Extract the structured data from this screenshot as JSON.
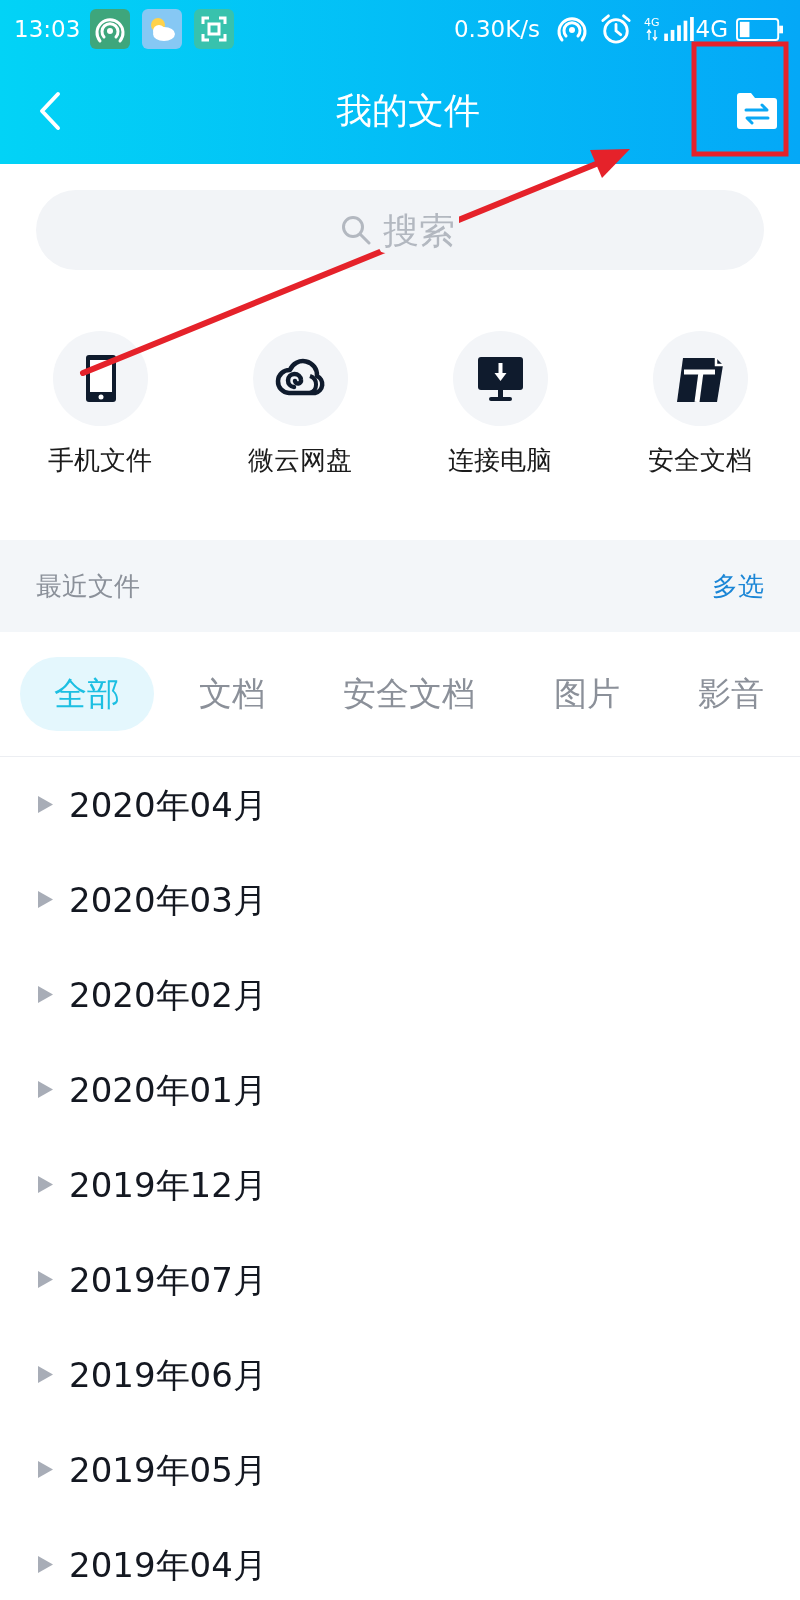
{
  "status_bar": {
    "time": "13:03",
    "net_speed": "0.30K/s",
    "network_badge": "4G",
    "network": "4G"
  },
  "header": {
    "title": "我的文件"
  },
  "search": {
    "placeholder": "搜索"
  },
  "shortcuts": [
    {
      "kind": "phone",
      "label": "手机文件"
    },
    {
      "kind": "cloud",
      "label": "微云网盘"
    },
    {
      "kind": "computer",
      "label": "连接电脑"
    },
    {
      "kind": "secure-doc",
      "label": "安全文档"
    }
  ],
  "recent": {
    "title": "最近文件",
    "action": "多选"
  },
  "tabs": [
    {
      "label": "全部",
      "selected": true
    },
    {
      "label": "文档",
      "selected": false
    },
    {
      "label": "安全文档",
      "selected": false
    },
    {
      "label": "图片",
      "selected": false
    },
    {
      "label": "影音",
      "selected": false
    }
  ],
  "months": [
    {
      "label": "2020年04月",
      "expanded": false
    },
    {
      "label": "2020年03月",
      "expanded": false
    },
    {
      "label": "2020年02月",
      "expanded": false
    },
    {
      "label": "2020年01月",
      "expanded": false
    },
    {
      "label": "2019年12月",
      "expanded": false
    },
    {
      "label": "2019年07月",
      "expanded": false
    },
    {
      "label": "2019年06月",
      "expanded": false
    },
    {
      "label": "2019年05月",
      "expanded": false
    },
    {
      "label": "2019年04月",
      "expanded": false
    }
  ],
  "annotations": {
    "arrow": true,
    "highlight_frame": true
  }
}
